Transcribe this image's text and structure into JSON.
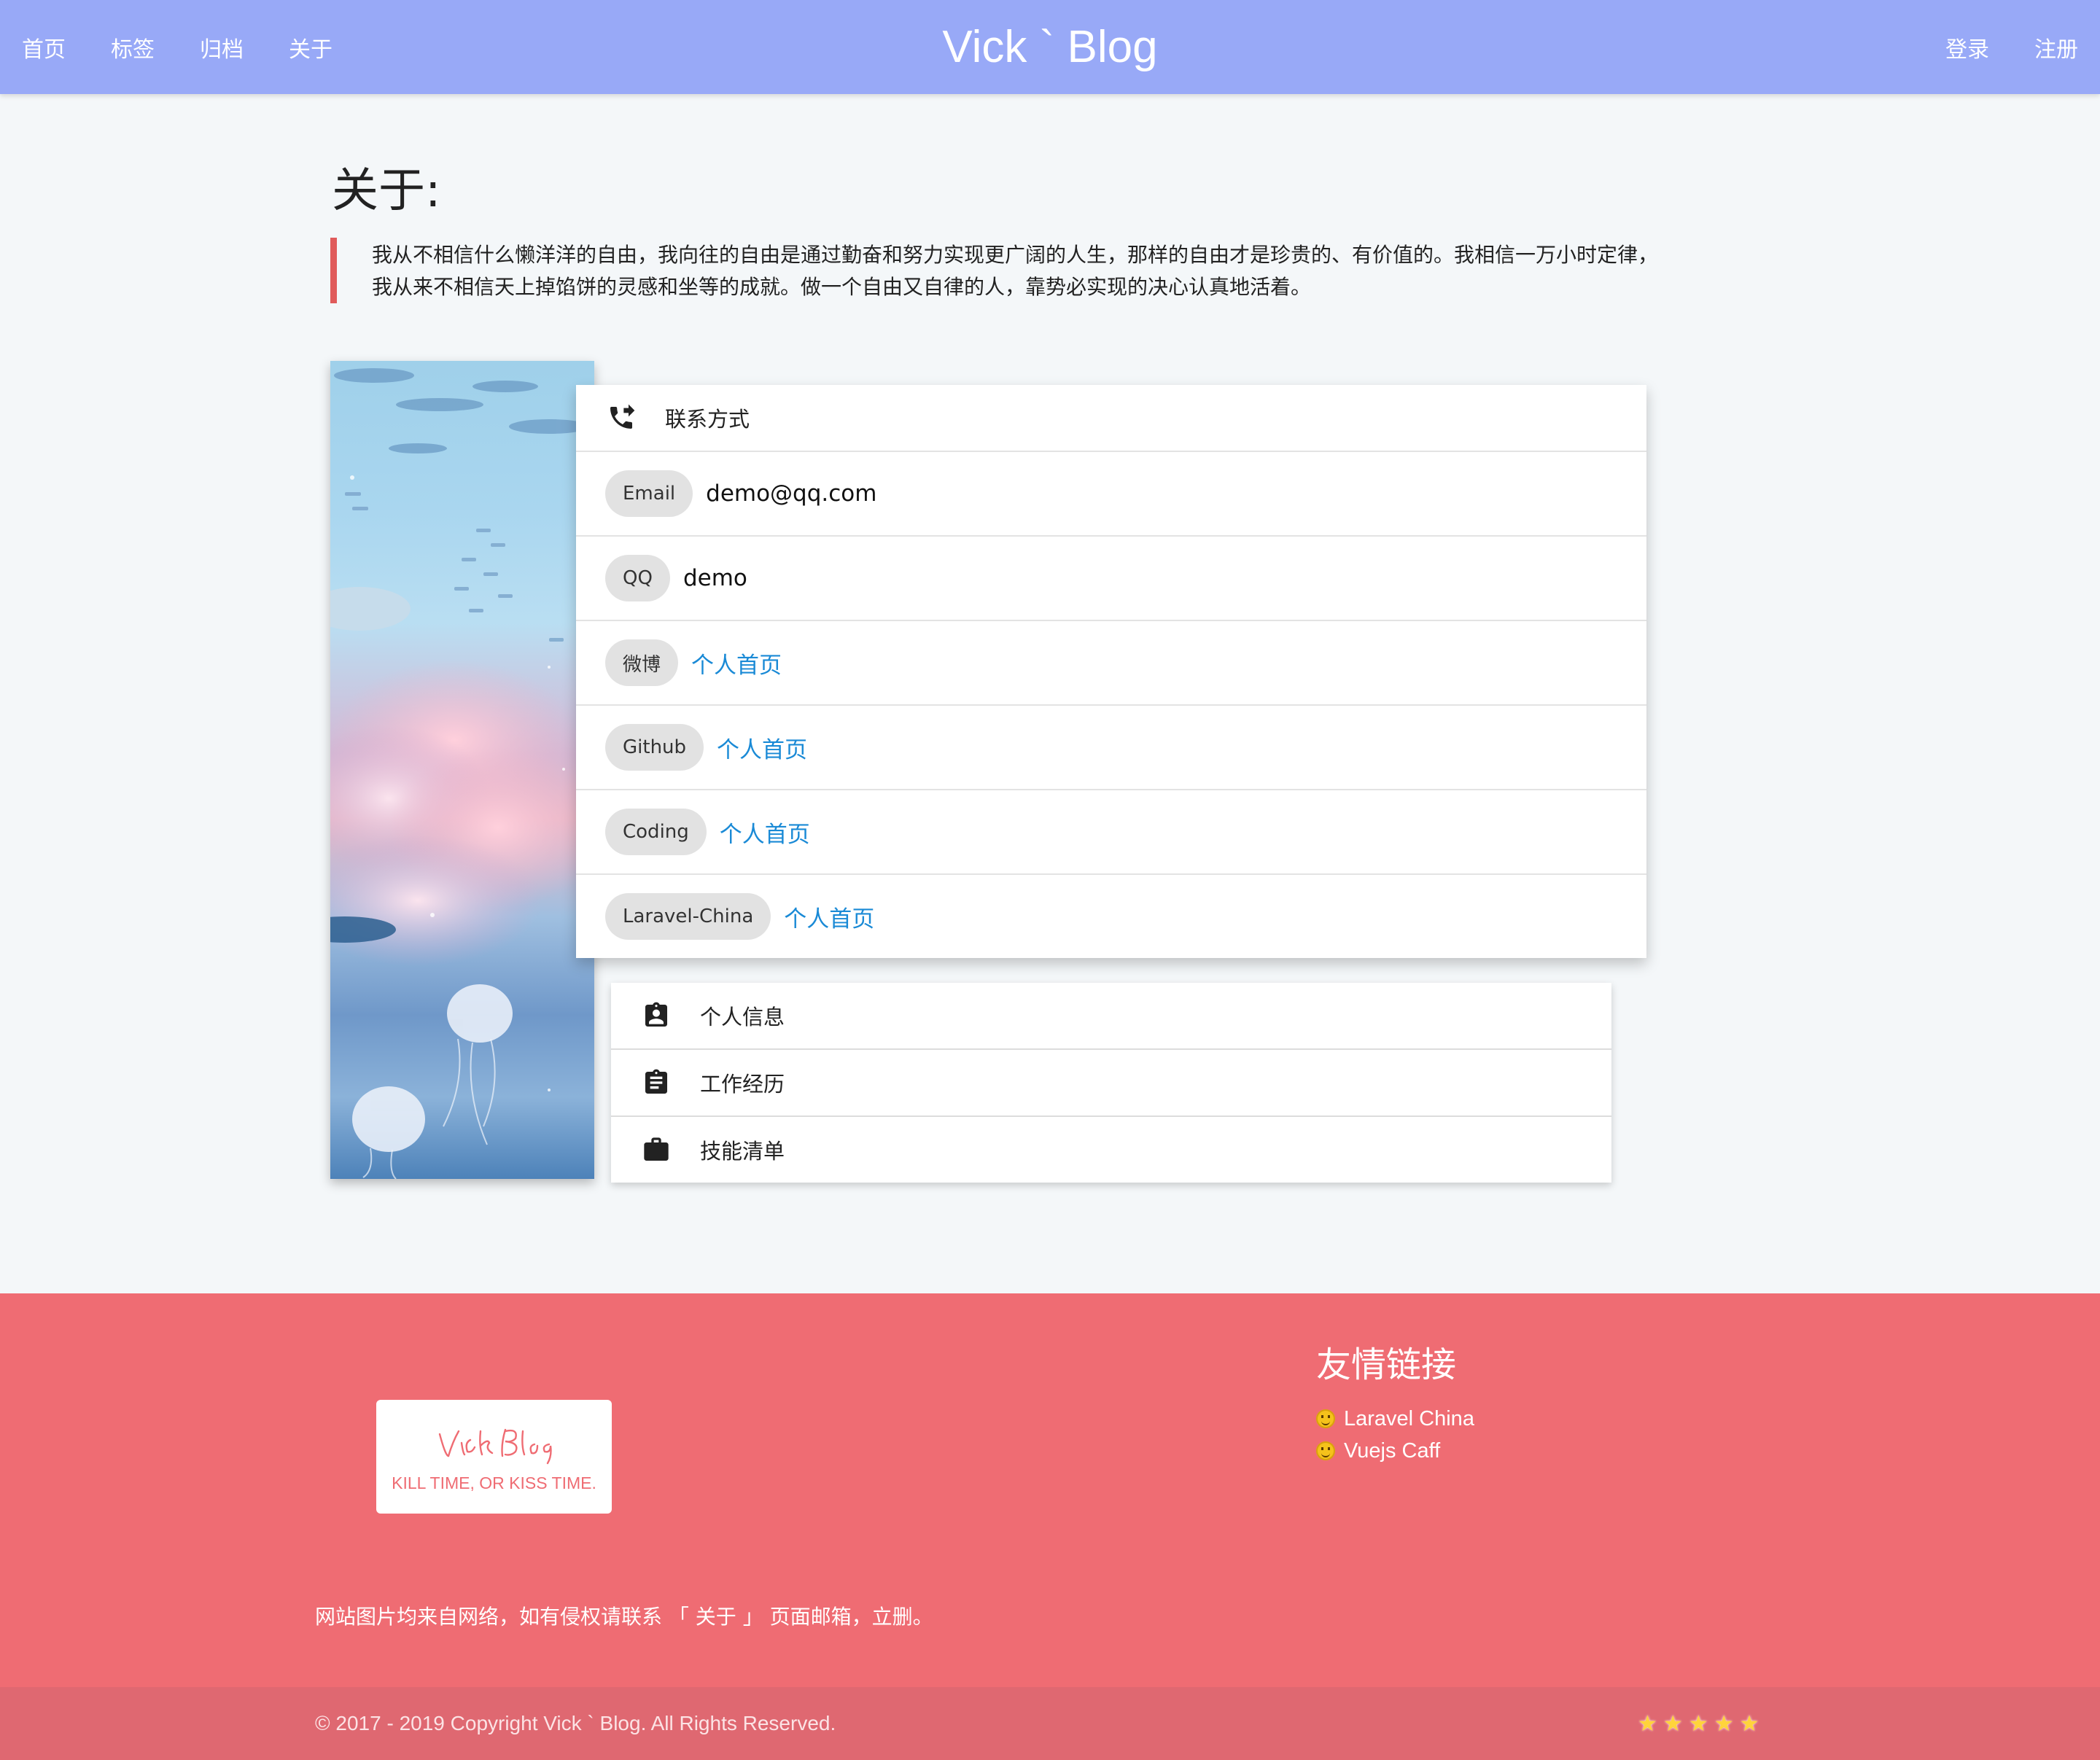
{
  "nav": {
    "left": [
      "首页",
      "标签",
      "归档",
      "关于"
    ],
    "brand": "Vick ` Blog",
    "right": [
      "登录",
      "注册"
    ]
  },
  "about": {
    "title": "关于:",
    "quote_line1": "我从不相信什么懒洋洋的自由，我向往的自由是通过勤奋和努力实现更广阔的人生，那样的自由才是珍贵的、有价值的。我相信一万小时定律，",
    "quote_line2": "我从来不相信天上掉馅饼的灵感和坐等的成就。做一个自由又自律的人，靠势必实现的决心认真地活着。"
  },
  "contact": {
    "title": "联系方式",
    "icon": "phone-forwarded-icon",
    "rows": [
      {
        "label": "Email",
        "value": "demo@qq.com",
        "is_link": false
      },
      {
        "label": "QQ",
        "value": "demo",
        "is_link": false
      },
      {
        "label": "微博",
        "value": "个人首页",
        "is_link": true
      },
      {
        "label": "Github",
        "value": "个人首页",
        "is_link": true
      },
      {
        "label": "Coding",
        "value": "个人首页",
        "is_link": true
      },
      {
        "label": "Laravel-China",
        "value": "个人首页",
        "is_link": true
      }
    ]
  },
  "sections": [
    {
      "label": "个人信息",
      "icon": "contact-card-icon"
    },
    {
      "label": "工作经历",
      "icon": "clipboard-icon"
    },
    {
      "label": "技能清单",
      "icon": "briefcase-icon"
    }
  ],
  "footer": {
    "logo_script": "Vick Blog",
    "logo_tagline": "KILL TIME, OR KISS TIME.",
    "friends_title": "友情链接",
    "friends": [
      "Laravel China",
      "Vuejs Caff"
    ],
    "disclaimer": "网站图片均来自网络，如有侵权请联系 「 关于 」 页面邮箱，立删。",
    "copyright": "© 2017 - 2019 Copyright Vick ` Blog. All Rights Reserved.",
    "stars": 5
  },
  "colors": {
    "nav_bg": "#98a9f7",
    "footer_bg": "#ef6c73",
    "footer_bottom_bg": "#df6871",
    "link": "#1a8ad6",
    "quote_border": "#e05b5b"
  }
}
